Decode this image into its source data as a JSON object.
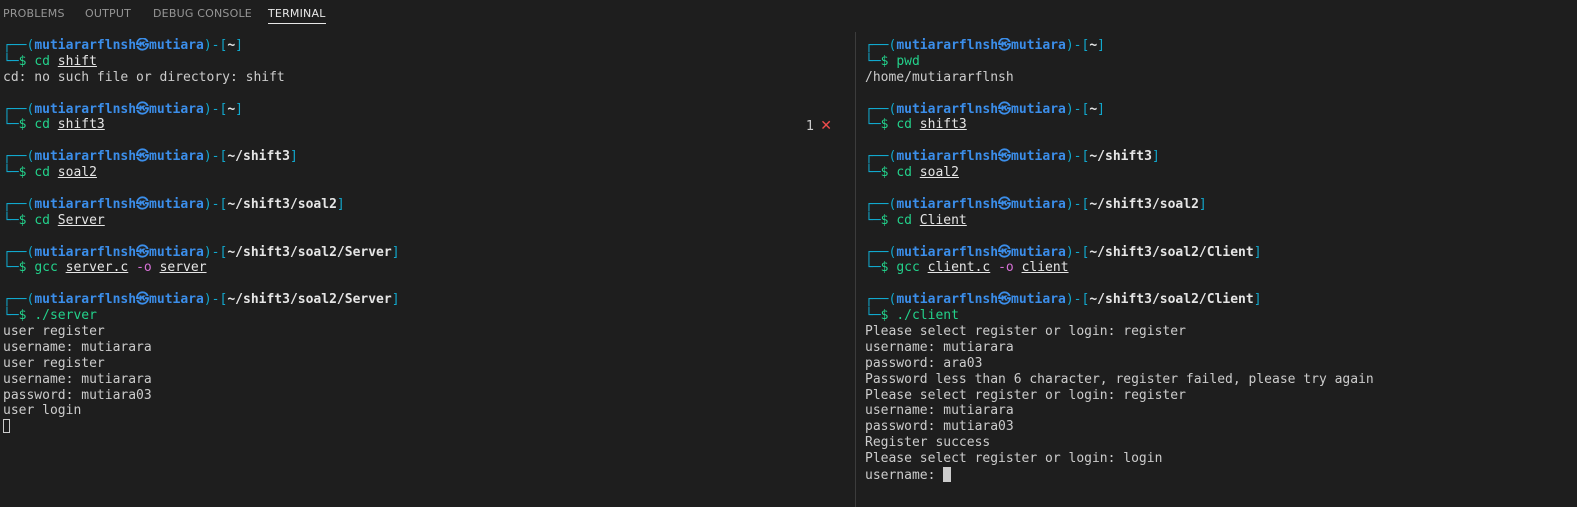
{
  "tabs": [
    "PROBLEMS",
    "OUTPUT",
    "DEBUG CONSOLE",
    "TERMINAL"
  ],
  "active_tab": "TERMINAL",
  "prompt": {
    "user": "mutiararflnsh",
    "sep": "㉿",
    "host": "mutiara",
    "dollar": "$"
  },
  "error_badge": {
    "count": "1",
    "icon": "✕"
  },
  "left": {
    "blocks": [
      {
        "dir": "~",
        "cmd": "cd",
        "args": [
          "shift"
        ],
        "output": [
          "cd: no such file or directory: shift"
        ]
      },
      {
        "dir": "~",
        "cmd": "cd",
        "args": [
          "shift3"
        ],
        "output": []
      },
      {
        "dir": "~/shift3",
        "cmd": "cd",
        "args": [
          "soal2"
        ],
        "output": []
      },
      {
        "dir": "~/shift3/soal2",
        "cmd": "cd",
        "args": [
          "Server"
        ],
        "output": []
      },
      {
        "dir": "~/shift3/soal2/Server",
        "cmd": "gcc",
        "args": [
          "server.c",
          "-o",
          "server"
        ],
        "output": []
      },
      {
        "dir": "~/shift3/soal2/Server",
        "cmd": "./server",
        "args": [],
        "output": [
          "user register",
          "username: mutiarara",
          "user register",
          "username: mutiarara",
          "password: mutiara03",
          "user login"
        ]
      }
    ]
  },
  "right": {
    "blocks": [
      {
        "dir": "~",
        "cmd": "pwd",
        "args": [],
        "output": [
          "/home/mutiararflnsh"
        ]
      },
      {
        "dir": "~",
        "cmd": "cd",
        "args": [
          "shift3"
        ],
        "output": []
      },
      {
        "dir": "~/shift3",
        "cmd": "cd",
        "args": [
          "soal2"
        ],
        "output": []
      },
      {
        "dir": "~/shift3/soal2",
        "cmd": "cd",
        "args": [
          "Client"
        ],
        "output": []
      },
      {
        "dir": "~/shift3/soal2/Client",
        "cmd": "gcc",
        "args": [
          "client.c",
          "-o",
          "client"
        ],
        "output": []
      },
      {
        "dir": "~/shift3/soal2/Client",
        "cmd": "./client",
        "args": [],
        "output": [
          "Please select register or login: register",
          "username: mutiarara",
          "password: ara03",
          "Password less than 6 character, register failed, please try again",
          "Please select register or login: register",
          "username: mutiarara",
          "password: mutiara03",
          "Register success",
          "Please select register or login: login"
        ]
      }
    ],
    "last_input": "username: "
  }
}
